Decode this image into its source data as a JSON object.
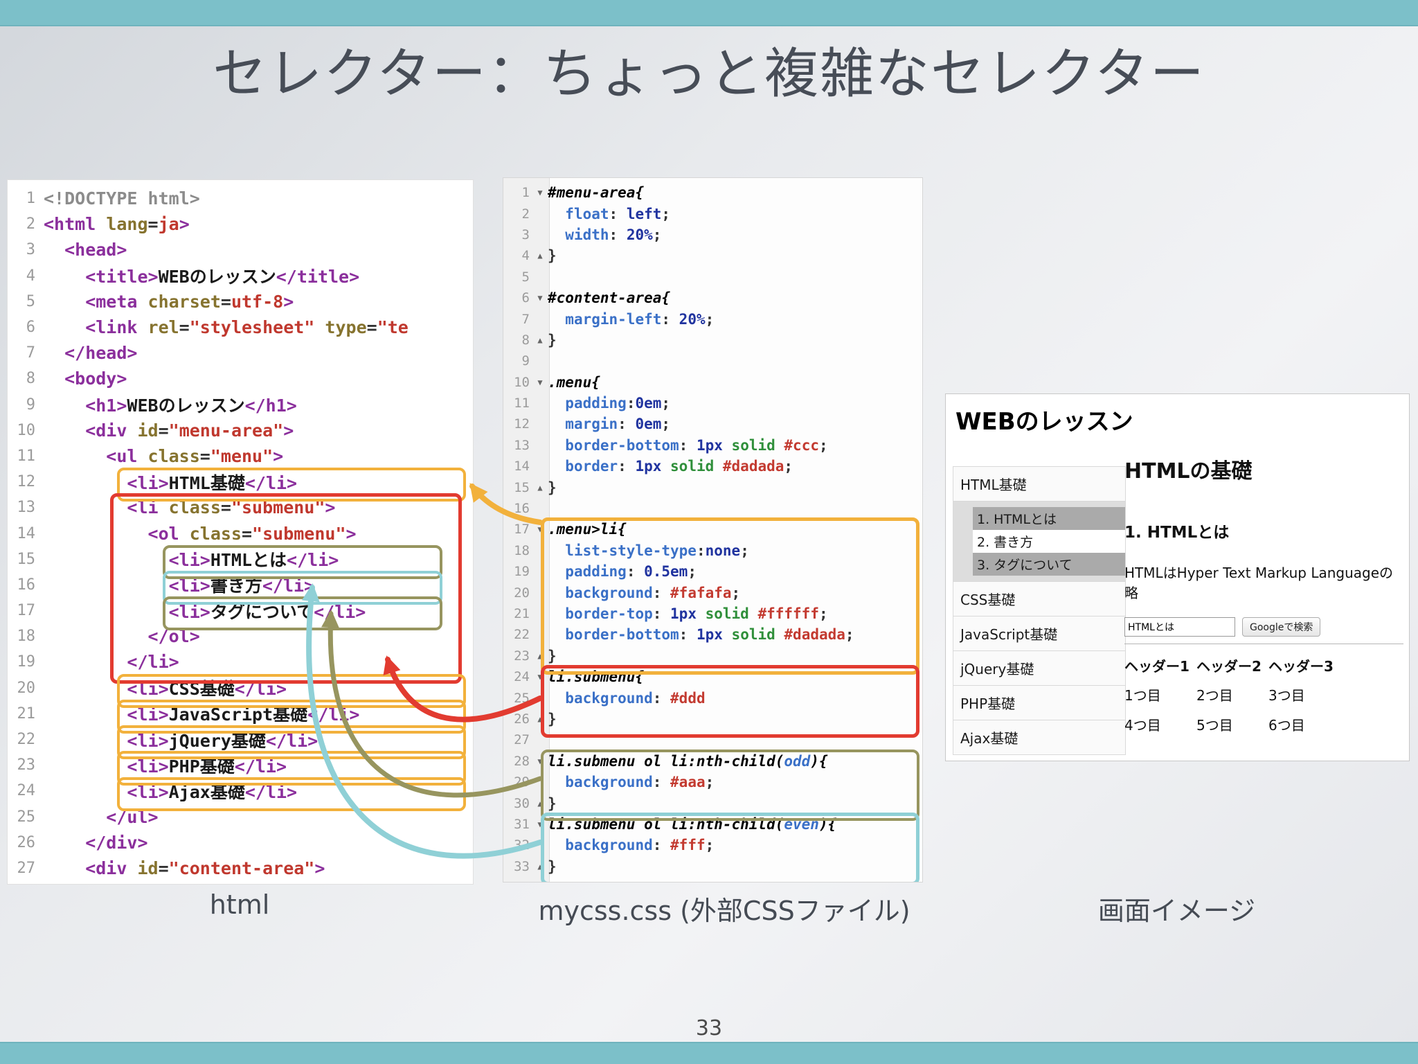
{
  "slide": {
    "title": "セレクター：ちょっと複雑なセレクター",
    "page_number": "33",
    "accent_color": "#7cc0c9"
  },
  "labels": {
    "html_panel": "html",
    "css_panel": "mycss.css (外部CSSファイル)",
    "preview_panel": "画面イメージ"
  },
  "annotations": {
    "yellow": "#f2b13c",
    "red": "#e23b30",
    "olive": "#97955f",
    "cyan": "#8fd0d6"
  },
  "html_code": {
    "lines": [
      {
        "n": 1,
        "tk": [
          [
            "<!DOCTYPE html>",
            "gray"
          ]
        ]
      },
      {
        "n": 2,
        "tk": [
          [
            "<html ",
            "tag"
          ],
          [
            "lang",
            "attr"
          ],
          [
            "=",
            "pl"
          ],
          [
            "ja",
            "str"
          ],
          [
            ">",
            "tag"
          ]
        ]
      },
      {
        "n": 3,
        "tk": [
          [
            "  <head>",
            "tag"
          ]
        ]
      },
      {
        "n": 4,
        "tk": [
          [
            "    <title>",
            "tag"
          ],
          [
            "WEBのレッスン",
            "text"
          ],
          [
            "</title>",
            "tag"
          ]
        ]
      },
      {
        "n": 5,
        "tk": [
          [
            "    <meta ",
            "tag"
          ],
          [
            "charset",
            "attr"
          ],
          [
            "=",
            "pl"
          ],
          [
            "utf-8",
            "str"
          ],
          [
            ">",
            "tag"
          ]
        ]
      },
      {
        "n": 6,
        "tk": [
          [
            "    <link ",
            "tag"
          ],
          [
            "rel",
            "attr"
          ],
          [
            "=",
            "pl"
          ],
          [
            "\"stylesheet\"",
            "str"
          ],
          [
            " ",
            "pl"
          ],
          [
            "type",
            "attr"
          ],
          [
            "=",
            "pl"
          ],
          [
            "\"te",
            "str"
          ]
        ]
      },
      {
        "n": 7,
        "tk": [
          [
            "  </head>",
            "tag"
          ]
        ]
      },
      {
        "n": 8,
        "tk": [
          [
            "  <body>",
            "tag"
          ]
        ]
      },
      {
        "n": 9,
        "tk": [
          [
            "    <h1>",
            "tag"
          ],
          [
            "WEBのレッスン",
            "text"
          ],
          [
            "</h1>",
            "tag"
          ]
        ]
      },
      {
        "n": 10,
        "tk": [
          [
            "    <div ",
            "tag"
          ],
          [
            "id",
            "attr"
          ],
          [
            "=",
            "pl"
          ],
          [
            "\"menu-area\"",
            "str"
          ],
          [
            ">",
            "tag"
          ]
        ]
      },
      {
        "n": 11,
        "tk": [
          [
            "      <ul ",
            "tag"
          ],
          [
            "class",
            "attr"
          ],
          [
            "=",
            "pl"
          ],
          [
            "\"menu\"",
            "str"
          ],
          [
            ">",
            "tag"
          ]
        ]
      },
      {
        "n": 12,
        "tk": [
          [
            "        <li>",
            "tag"
          ],
          [
            "HTML基礎",
            "text"
          ],
          [
            "</li>",
            "tag"
          ]
        ]
      },
      {
        "n": 13,
        "tk": [
          [
            "        <li ",
            "tag"
          ],
          [
            "class",
            "attr"
          ],
          [
            "=",
            "pl"
          ],
          [
            "\"submenu\"",
            "str"
          ],
          [
            ">",
            "tag"
          ]
        ]
      },
      {
        "n": 14,
        "tk": [
          [
            "          <ol ",
            "tag"
          ],
          [
            "class",
            "attr"
          ],
          [
            "=",
            "pl"
          ],
          [
            "\"submenu\"",
            "str"
          ],
          [
            ">",
            "tag"
          ]
        ]
      },
      {
        "n": 15,
        "tk": [
          [
            "            <li>",
            "tag"
          ],
          [
            "HTMLとは",
            "text"
          ],
          [
            "</li>",
            "tag"
          ]
        ]
      },
      {
        "n": 16,
        "tk": [
          [
            "            <li>",
            "tag"
          ],
          [
            "書き方",
            "text"
          ],
          [
            "</li>",
            "tag"
          ]
        ]
      },
      {
        "n": 17,
        "tk": [
          [
            "            <li>",
            "tag"
          ],
          [
            "タグについて",
            "text"
          ],
          [
            "</li>",
            "tag"
          ]
        ]
      },
      {
        "n": 18,
        "tk": [
          [
            "          </ol>",
            "tag"
          ]
        ]
      },
      {
        "n": 19,
        "tk": [
          [
            "        </li>",
            "tag"
          ]
        ]
      },
      {
        "n": 20,
        "tk": [
          [
            "        <li>",
            "tag"
          ],
          [
            "CSS基礎",
            "text"
          ],
          [
            "</li>",
            "tag"
          ]
        ]
      },
      {
        "n": 21,
        "tk": [
          [
            "        <li>",
            "tag"
          ],
          [
            "JavaScript基礎",
            "text"
          ],
          [
            "</li>",
            "tag"
          ]
        ]
      },
      {
        "n": 22,
        "tk": [
          [
            "        <li>",
            "tag"
          ],
          [
            "jQuery基礎",
            "text"
          ],
          [
            "</li>",
            "tag"
          ]
        ]
      },
      {
        "n": 23,
        "tk": [
          [
            "        <li>",
            "tag"
          ],
          [
            "PHP基礎",
            "text"
          ],
          [
            "</li>",
            "tag"
          ]
        ]
      },
      {
        "n": 24,
        "tk": [
          [
            "        <li>",
            "tag"
          ],
          [
            "Ajax基礎",
            "text"
          ],
          [
            "</li>",
            "tag"
          ]
        ]
      },
      {
        "n": 25,
        "tk": [
          [
            "      </ul>",
            "tag"
          ]
        ]
      },
      {
        "n": 26,
        "tk": [
          [
            "    </div>",
            "tag"
          ]
        ]
      },
      {
        "n": 27,
        "tk": [
          [
            "    <div ",
            "tag"
          ],
          [
            "id",
            "attr"
          ],
          [
            "=",
            "pl"
          ],
          [
            "\"content-area\"",
            "str"
          ],
          [
            ">",
            "tag"
          ]
        ]
      }
    ]
  },
  "css_code": {
    "lines": [
      {
        "n": 1,
        "f": "v",
        "tk": [
          [
            "#menu-area{",
            "sel"
          ]
        ]
      },
      {
        "n": 2,
        "f": "",
        "tk": [
          [
            "  ",
            "pl"
          ],
          [
            "float",
            "prop"
          ],
          [
            ": ",
            "pl"
          ],
          [
            "left",
            "val"
          ],
          [
            ";",
            "pl"
          ]
        ]
      },
      {
        "n": 3,
        "f": "",
        "tk": [
          [
            "  ",
            "pl"
          ],
          [
            "width",
            "prop"
          ],
          [
            ": ",
            "pl"
          ],
          [
            "20%",
            "val"
          ],
          [
            ";",
            "pl"
          ]
        ]
      },
      {
        "n": 4,
        "f": "^",
        "tk": [
          [
            "}",
            "pl"
          ]
        ]
      },
      {
        "n": 5,
        "f": "",
        "tk": []
      },
      {
        "n": 6,
        "f": "v",
        "tk": [
          [
            "#content-area{",
            "sel"
          ]
        ]
      },
      {
        "n": 7,
        "f": "",
        "tk": [
          [
            "  ",
            "pl"
          ],
          [
            "margin-left",
            "prop"
          ],
          [
            ": ",
            "pl"
          ],
          [
            "20%",
            "val"
          ],
          [
            ";",
            "pl"
          ]
        ]
      },
      {
        "n": 8,
        "f": "^",
        "tk": [
          [
            "}",
            "pl"
          ]
        ]
      },
      {
        "n": 9,
        "f": "",
        "tk": []
      },
      {
        "n": 10,
        "f": "v",
        "tk": [
          [
            ".menu{",
            "sel"
          ]
        ]
      },
      {
        "n": 11,
        "f": "",
        "tk": [
          [
            "  ",
            "pl"
          ],
          [
            "padding",
            "prop"
          ],
          [
            ":",
            "pl"
          ],
          [
            "0em",
            "val"
          ],
          [
            ";",
            "pl"
          ]
        ]
      },
      {
        "n": 12,
        "f": "",
        "tk": [
          [
            "  ",
            "pl"
          ],
          [
            "margin",
            "prop"
          ],
          [
            ": ",
            "pl"
          ],
          [
            "0em",
            "val"
          ],
          [
            ";",
            "pl"
          ]
        ]
      },
      {
        "n": 13,
        "f": "",
        "tk": [
          [
            "  ",
            "pl"
          ],
          [
            "border-bottom",
            "prop"
          ],
          [
            ": ",
            "pl"
          ],
          [
            "1px",
            "val"
          ],
          [
            " solid",
            "key"
          ],
          [
            " #ccc",
            "hex"
          ],
          [
            ";",
            "pl"
          ]
        ]
      },
      {
        "n": 14,
        "f": "",
        "tk": [
          [
            "  ",
            "pl"
          ],
          [
            "border",
            "prop"
          ],
          [
            ": ",
            "pl"
          ],
          [
            "1px",
            "val"
          ],
          [
            " solid",
            "key"
          ],
          [
            " #dadada",
            "hex"
          ],
          [
            ";",
            "pl"
          ]
        ]
      },
      {
        "n": 15,
        "f": "^",
        "tk": [
          [
            "}",
            "pl"
          ]
        ]
      },
      {
        "n": 16,
        "f": "",
        "tk": []
      },
      {
        "n": 17,
        "f": "v",
        "tk": [
          [
            ".menu>li{",
            "sel"
          ]
        ]
      },
      {
        "n": 18,
        "f": "",
        "tk": [
          [
            "  ",
            "pl"
          ],
          [
            "list-style-type",
            "prop"
          ],
          [
            ":",
            "pl"
          ],
          [
            "none",
            "val"
          ],
          [
            ";",
            "pl"
          ]
        ]
      },
      {
        "n": 19,
        "f": "",
        "tk": [
          [
            "  ",
            "pl"
          ],
          [
            "padding",
            "prop"
          ],
          [
            ": ",
            "pl"
          ],
          [
            "0.5em",
            "val"
          ],
          [
            ";",
            "pl"
          ]
        ]
      },
      {
        "n": 20,
        "f": "",
        "tk": [
          [
            "  ",
            "pl"
          ],
          [
            "background",
            "prop"
          ],
          [
            ": ",
            "pl"
          ],
          [
            "#fafafa",
            "hex"
          ],
          [
            ";",
            "pl"
          ]
        ]
      },
      {
        "n": 21,
        "f": "",
        "tk": [
          [
            "  ",
            "pl"
          ],
          [
            "border-top",
            "prop"
          ],
          [
            ": ",
            "pl"
          ],
          [
            "1px",
            "val"
          ],
          [
            " solid",
            "key"
          ],
          [
            " #ffffff",
            "hex"
          ],
          [
            ";",
            "pl"
          ]
        ]
      },
      {
        "n": 22,
        "f": "",
        "tk": [
          [
            "  ",
            "pl"
          ],
          [
            "border-bottom",
            "prop"
          ],
          [
            ": ",
            "pl"
          ],
          [
            "1px",
            "val"
          ],
          [
            " solid",
            "key"
          ],
          [
            " #dadada",
            "hex"
          ],
          [
            ";",
            "pl"
          ]
        ]
      },
      {
        "n": 23,
        "f": "^",
        "tk": [
          [
            "}",
            "pl"
          ]
        ]
      },
      {
        "n": 24,
        "f": "v",
        "tk": [
          [
            "li.submenu{",
            "sel"
          ]
        ]
      },
      {
        "n": 25,
        "f": "",
        "tk": [
          [
            "  ",
            "pl"
          ],
          [
            "background",
            "prop"
          ],
          [
            ": ",
            "pl"
          ],
          [
            "#ddd",
            "hex"
          ]
        ]
      },
      {
        "n": 26,
        "f": "^",
        "tk": [
          [
            "}",
            "pl"
          ]
        ]
      },
      {
        "n": 27,
        "f": "",
        "tk": []
      },
      {
        "n": 28,
        "f": "v",
        "tk": [
          [
            "li.submenu ol li:nth-child(",
            "sel"
          ],
          [
            "odd",
            "kw2"
          ],
          [
            "){",
            "sel"
          ]
        ]
      },
      {
        "n": 29,
        "f": "",
        "tk": [
          [
            "  ",
            "pl"
          ],
          [
            "background",
            "prop"
          ],
          [
            ": ",
            "pl"
          ],
          [
            "#aaa",
            "hex"
          ],
          [
            ";",
            "pl"
          ]
        ]
      },
      {
        "n": 30,
        "f": "^",
        "tk": [
          [
            "}",
            "pl"
          ]
        ]
      },
      {
        "n": 31,
        "f": "v",
        "tk": [
          [
            "li.submenu ol li:nth-child(",
            "sel"
          ],
          [
            "even",
            "kw2"
          ],
          [
            "){",
            "sel"
          ]
        ]
      },
      {
        "n": 32,
        "f": "",
        "tk": [
          [
            "  ",
            "pl"
          ],
          [
            "background",
            "prop"
          ],
          [
            ": ",
            "pl"
          ],
          [
            "#fff",
            "hex"
          ],
          [
            ";",
            "pl"
          ]
        ]
      },
      {
        "n": 33,
        "f": "^",
        "tk": [
          [
            "}",
            "pl"
          ]
        ]
      }
    ]
  },
  "preview": {
    "heading": "WEBのレッスン",
    "menu_items": [
      {
        "label": "HTML基礎"
      },
      {
        "submenu": [
          "1. HTMLとは",
          "2. 書き方",
          "3. タグについて"
        ]
      },
      {
        "label": "CSS基礎"
      },
      {
        "label": "JavaScript基礎"
      },
      {
        "label": "jQuery基礎"
      },
      {
        "label": "PHP基礎"
      },
      {
        "label": "Ajax基礎"
      }
    ],
    "content": {
      "title": "HTMLの基礎",
      "subtitle": "1. HTMLとは",
      "body": "HTMLはHyper Text Markup Languageの略",
      "search_value": "HTMLとは",
      "search_button": "Googleで検索",
      "table": {
        "headers": [
          "ヘッダー1",
          "ヘッダー2",
          "ヘッダー3"
        ],
        "rows": [
          [
            "1つ目",
            "2つ目",
            "3つ目"
          ],
          [
            "4つ目",
            "5つ目",
            "6つ目"
          ]
        ]
      }
    }
  }
}
